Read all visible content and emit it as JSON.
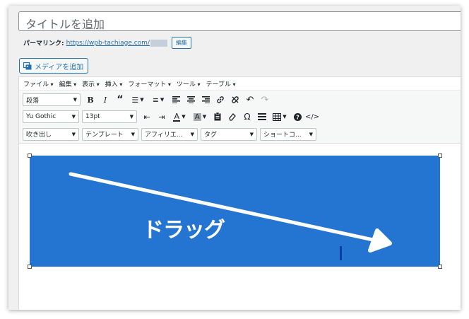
{
  "title": {
    "placeholder": "タイトルを追加"
  },
  "permalink": {
    "label": "パーマリンク:",
    "url": "https://wpb-tachiage.com/",
    "edit_label": "編集"
  },
  "media": {
    "button_label": "メディアを追加"
  },
  "menubar": {
    "items": [
      "ファイル",
      "編集",
      "表示",
      "挿入",
      "フォーマット",
      "ツール",
      "テーブル"
    ]
  },
  "toolbar1": {
    "format_select": "段落"
  },
  "toolbar2": {
    "font_family": "Yu Gothic",
    "font_size": "13pt"
  },
  "toolbar3": {
    "selects": [
      "吹き出し",
      "テンプレート",
      "アフィリエ...",
      "タグ",
      "ショートコ..."
    ]
  },
  "content": {
    "banner_text": "ドラッグ",
    "banner_color": "#2475d1"
  },
  "colors": {
    "accent": "#2271b1",
    "banner": "#2475d1",
    "arrow": "#ffffff"
  }
}
